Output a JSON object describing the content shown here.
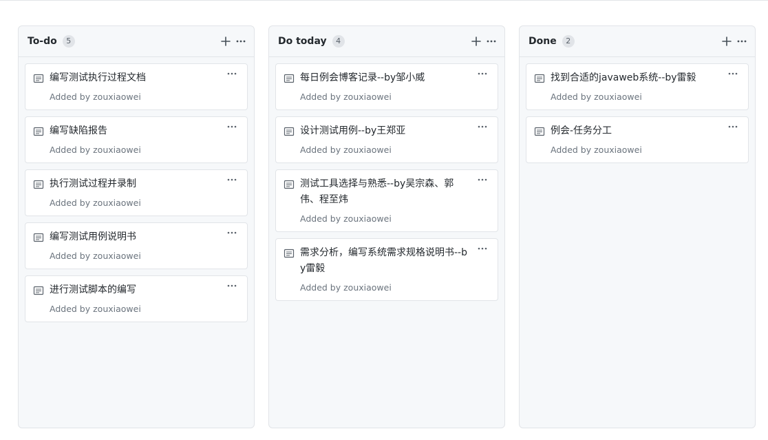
{
  "columns": [
    {
      "title": "To-do",
      "count": "5",
      "cards": [
        {
          "title": "编写测试执行过程文档",
          "meta": "Added by zouxiaowei"
        },
        {
          "title": "编写缺陷报告",
          "meta": "Added by zouxiaowei"
        },
        {
          "title": "执行测试过程并录制",
          "meta": "Added by zouxiaowei"
        },
        {
          "title": "编写测试用例说明书",
          "meta": "Added by zouxiaowei"
        },
        {
          "title": "进行测试脚本的编写",
          "meta": "Added by zouxiaowei"
        }
      ]
    },
    {
      "title": "Do today",
      "count": "4",
      "cards": [
        {
          "title": "每日例会博客记录--by邹小威",
          "meta": "Added by zouxiaowei"
        },
        {
          "title": "设计测试用例--by王郑亚",
          "meta": "Added by zouxiaowei"
        },
        {
          "title": "测试工具选择与熟悉--by吴宗森、郭伟、程至炜",
          "meta": "Added by zouxiaowei"
        },
        {
          "title": "需求分析，编写系统需求规格说明书--by雷毅",
          "meta": "Added by zouxiaowei"
        }
      ]
    },
    {
      "title": "Done",
      "count": "2",
      "cards": [
        {
          "title": "找到合适的javaweb系统--by雷毅",
          "meta": "Added by zouxiaowei"
        },
        {
          "title": "例会-任务分工",
          "meta": "Added by zouxiaowei"
        }
      ]
    }
  ],
  "icons": {
    "add": "plus-icon",
    "menu": "dots-horizontal-icon",
    "note": "note-icon"
  },
  "colors": {
    "column_bg": "#f6f8fa",
    "border": "#e1e4e8",
    "text": "#24292e",
    "muted": "#6a737d"
  }
}
